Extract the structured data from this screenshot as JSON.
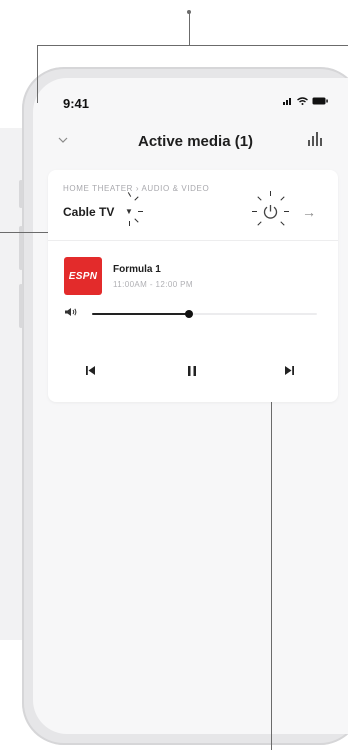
{
  "status_bar": {
    "time": "9:41",
    "icons": [
      "signal-icon",
      "wifi-icon",
      "battery-icon"
    ]
  },
  "header": {
    "title": "Active media (1)",
    "back_icon": "chevron-down-icon",
    "action_icon": "equalizer-icon"
  },
  "card": {
    "breadcrumb": "HOME THEATER  ›  AUDIO & VIDEO",
    "source": {
      "label": "Cable TV",
      "caret_icon": "caret-down-icon"
    },
    "power_icon": "power-icon",
    "open_icon": "arrow-right-icon",
    "program": {
      "channel_logo": "ESPN",
      "title": "Formula 1",
      "time": "11:00AM - 12:00 PM"
    },
    "volume": {
      "level": 0.43,
      "icon": "speaker-icon"
    },
    "controls": {
      "previous": "⏮",
      "pause": "⏸",
      "next": "⏭"
    }
  },
  "colors": {
    "accent_logo": "#e32b2b",
    "background": "#f7f7f8",
    "card": "#ffffff"
  }
}
